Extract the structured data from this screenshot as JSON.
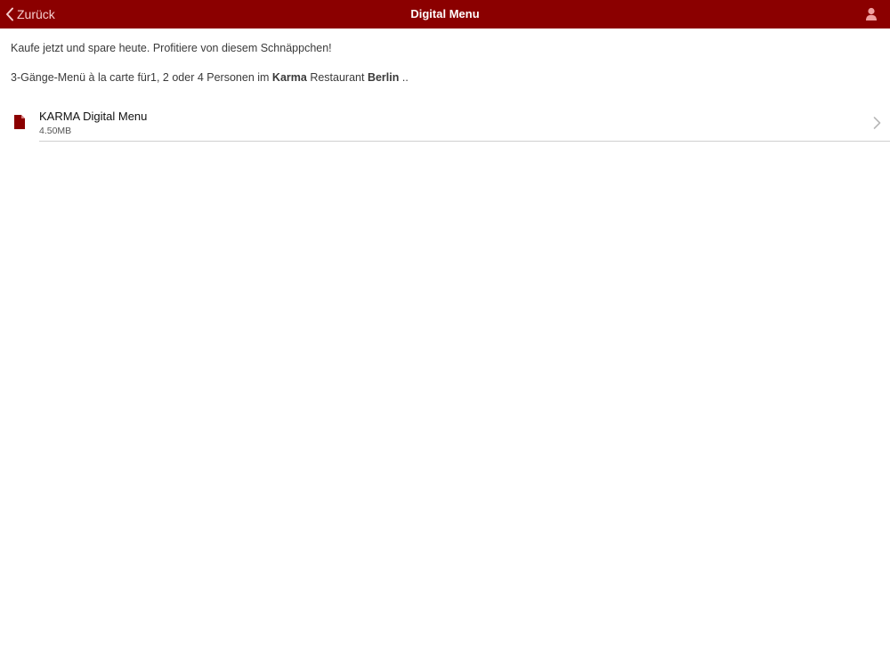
{
  "navbar": {
    "back_label": "Zurück",
    "title": "Digital Menu",
    "accent_color": "#8b0000",
    "back_icon": "chevron-left-icon",
    "user_icon": "user-icon"
  },
  "content": {
    "promo_text": "Kaufe jetzt und spare heute. Profitiere von diesem Schnäppchen!",
    "description": {
      "part1": "3-Gänge-Menü à la carte für1, 2 oder 4 Personen im ",
      "bold1": "Karma",
      "part2": " Restaurant ",
      "bold2": "Berlin",
      "part3": " .."
    }
  },
  "files": [
    {
      "name": "KARMA Digital Menu",
      "size": "4.50MB",
      "icon": "document-icon"
    }
  ]
}
